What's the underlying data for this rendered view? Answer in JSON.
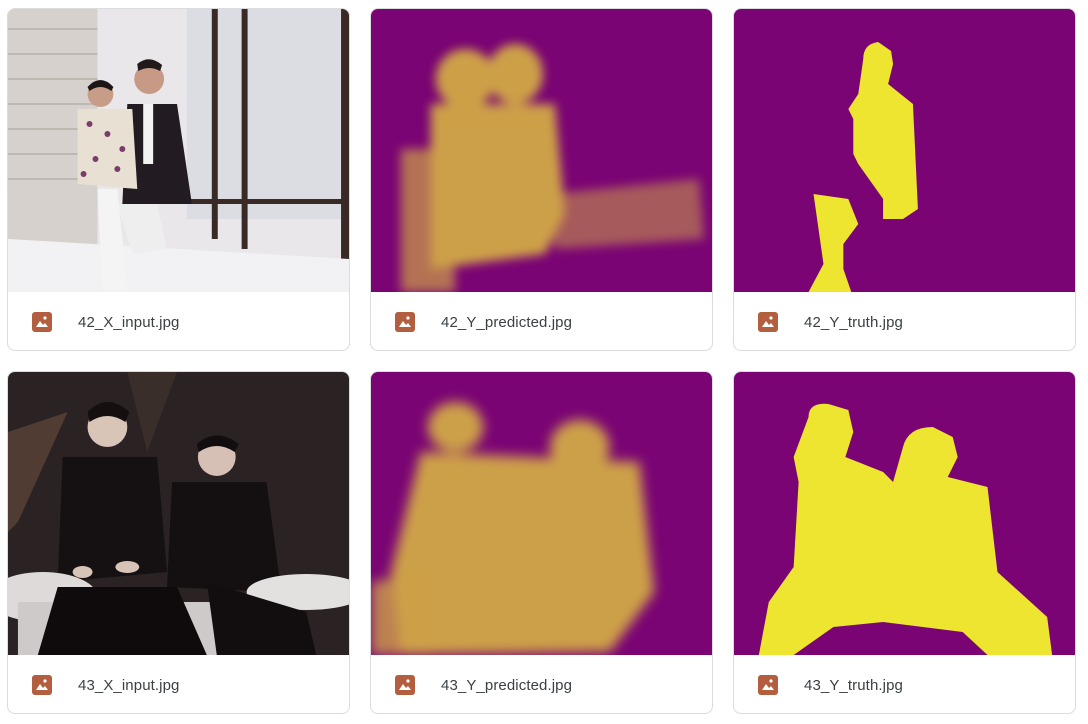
{
  "files": [
    {
      "name": "42_X_input.jpg",
      "kind": "photo-family",
      "icon": "image-icon"
    },
    {
      "name": "42_Y_predicted.jpg",
      "kind": "mask-predicted-42",
      "icon": "image-icon"
    },
    {
      "name": "42_Y_truth.jpg",
      "kind": "mask-truth-42",
      "icon": "image-icon"
    },
    {
      "name": "43_X_input.jpg",
      "kind": "photo-duo",
      "icon": "image-icon"
    },
    {
      "name": "43_Y_predicted.jpg",
      "kind": "mask-predicted-43",
      "icon": "image-icon"
    },
    {
      "name": "43_Y_truth.jpg",
      "kind": "mask-truth-43",
      "icon": "image-icon"
    }
  ],
  "colors": {
    "mask_background": "#7a0474",
    "mask_truth": "#ede530",
    "mask_predicted": "#d4ae45",
    "file_icon": "#b35f3f"
  }
}
